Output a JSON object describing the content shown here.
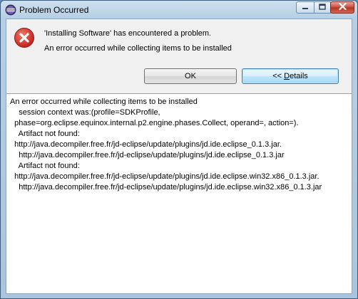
{
  "window": {
    "title": "Problem Occurred"
  },
  "message": {
    "main": "'Installing Software' has encountered a problem.",
    "sub": "An error occurred while collecting items to be installed"
  },
  "buttons": {
    "ok_label": "OK",
    "details_prefix": "<< ",
    "details_accel": "D",
    "details_rest": "etails"
  },
  "details": {
    "lines": [
      "An error occurred while collecting items to be installed",
      "    session context was:(profile=SDKProfile,",
      "  phase=org.eclipse.equinox.internal.p2.engine.phases.Collect, operand=, action=).",
      "    Artifact not found:",
      "  http://java.decompiler.free.fr/jd-eclipse/update/plugins/jd.ide.eclipse_0.1.3.jar.",
      "    http://java.decompiler.free.fr/jd-eclipse/update/plugins/jd.ide.eclipse_0.1.3.jar",
      "    Artifact not found:",
      "  http://java.decompiler.free.fr/jd-eclipse/update/plugins/jd.ide.eclipse.win32.x86_0.1.3.jar.",
      "    http://java.decompiler.free.fr/jd-eclipse/update/plugins/jd.ide.eclipse.win32.x86_0.1.3.jar"
    ]
  },
  "icons": {
    "app": "eclipse-icon",
    "error": "error-icon",
    "minimize": "minimize-icon",
    "maximize": "maximize-icon",
    "close": "close-icon"
  },
  "colors": {
    "error_red": "#d42b1e",
    "close_button": "#c8493a",
    "details_focus": "#3c7fb1"
  }
}
